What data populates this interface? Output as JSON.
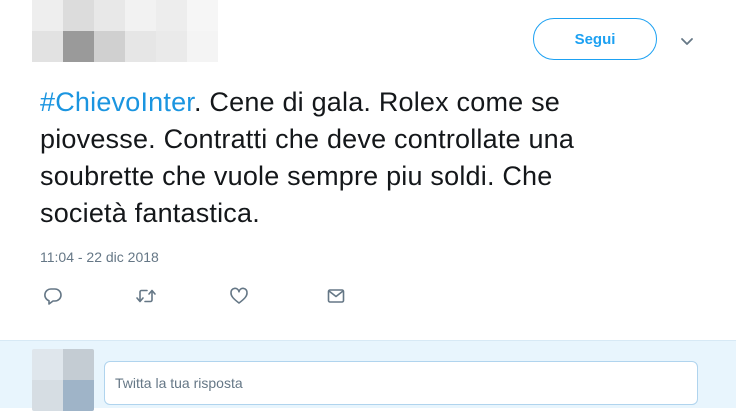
{
  "tweet": {
    "follow_label": "Segui",
    "caret_icon": "chevron-down-icon",
    "text_lines": [
      {
        "hashtag": "#ChievoInter",
        "rest": ". Cene di gala. Rolex come se"
      },
      {
        "hashtag": "",
        "rest": "piovesse. Contratti che deve controllate una"
      },
      {
        "hashtag": "",
        "rest": "soubrette che vuole sempre piu soldi. Che"
      },
      {
        "hashtag": "",
        "rest": "società fantastica."
      }
    ],
    "timestamp": "11:04 - 22 dic 2018",
    "actions": [
      {
        "name": "reply",
        "icon": "reply-icon"
      },
      {
        "name": "retweet",
        "icon": "retweet-icon"
      },
      {
        "name": "like",
        "icon": "heart-icon"
      },
      {
        "name": "direct-message",
        "icon": "envelope-icon"
      }
    ]
  },
  "reply": {
    "placeholder": "Twitta la tua risposta"
  },
  "colors": {
    "accent": "#1da1f2",
    "hashtag": "#1b95e0",
    "text": "#14171a",
    "muted": "#657786",
    "reply_background": "#e8f5fd"
  }
}
